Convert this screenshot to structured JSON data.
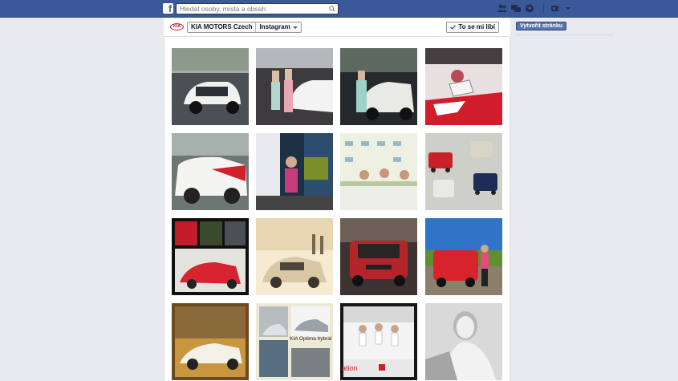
{
  "topbar": {
    "logo_letter": "f",
    "search_placeholder": "Hledat osoby, místa a obsah",
    "icons": [
      "friend-requests-icon",
      "messages-icon",
      "notifications-icon",
      "privacy-icon",
      "settings-icon"
    ]
  },
  "page_header": {
    "logo_text": "KIA",
    "page_name": "KIA MOTORS Czech",
    "section_name": "Instagram",
    "like_label": "To se mi líbí"
  },
  "right_column": {
    "create_page_label": "Vytvořit stránku"
  },
  "photos": [
    {
      "name": "photo-kia-sportage-white-garage"
    },
    {
      "name": "photo-couple-with-white-car"
    },
    {
      "name": "photo-woman-with-white-car"
    },
    {
      "name": "photo-car-wrap-graphic"
    },
    {
      "name": "photo-white-car-side"
    },
    {
      "name": "photo-woman-at-event"
    },
    {
      "name": "photo-press-conference"
    },
    {
      "name": "photo-kia-soul-collage"
    },
    {
      "name": "photo-soul-advert-collage"
    },
    {
      "name": "photo-kia-ceed-windmills"
    },
    {
      "name": "photo-red-kia-soul-front"
    },
    {
      "name": "photo-woman-with-red-soul"
    },
    {
      "name": "photo-white-ceed-sunset"
    },
    {
      "name": "photo-optima-hybrid-collage",
      "caption": "KIA Optima hybrid"
    },
    {
      "name": "photo-hostesses-at-stand",
      "caption": "ation"
    },
    {
      "name": "photo-woman-portrait-bw"
    }
  ],
  "colors": {
    "brand": "#3b5998",
    "kia_red": "#c4161c",
    "button": "#5b74a8"
  }
}
